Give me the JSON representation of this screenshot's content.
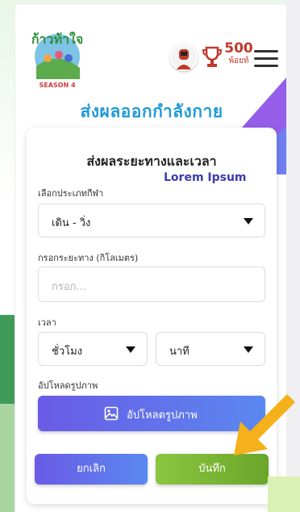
{
  "header": {
    "logo_text": "ก้าวท้าใจ",
    "logo_subtitle": "SEASON 4",
    "points_value": "500",
    "points_unit": "พ้อยท์"
  },
  "page": {
    "title": "ส่งผลออกกำลังกาย"
  },
  "form": {
    "title": "ส่งผลระยะทางและเวลา",
    "overlay_text": "Lorem Ipsum",
    "sport_label": "เลือกประเภทกีฬา",
    "sport_value": "เดิน - วิ่ง",
    "distance_label": "กรอกระยะทาง (กิโลเมตร)",
    "distance_placeholder": "กรอก...",
    "time_label": "เวลา",
    "hours_value": "ชั่วโมง",
    "minutes_value": "นาที",
    "upload_label": "อัปโหลดรูปภาพ",
    "upload_button": "อัปโหลดรูปภาพ",
    "cancel_button": "ยกเลิก",
    "save_button": "บันทึก"
  },
  "colors": {
    "title_blue": "#1f9ad6",
    "button_purple": "#6a5be6",
    "button_green": "#8cc53f",
    "points_red": "#c0392b",
    "arrow_orange": "#f5b01a"
  },
  "icons": [
    "trophy-icon",
    "menu-icon",
    "image-icon",
    "chevron-down-icon",
    "arrow-pointer-icon"
  ]
}
